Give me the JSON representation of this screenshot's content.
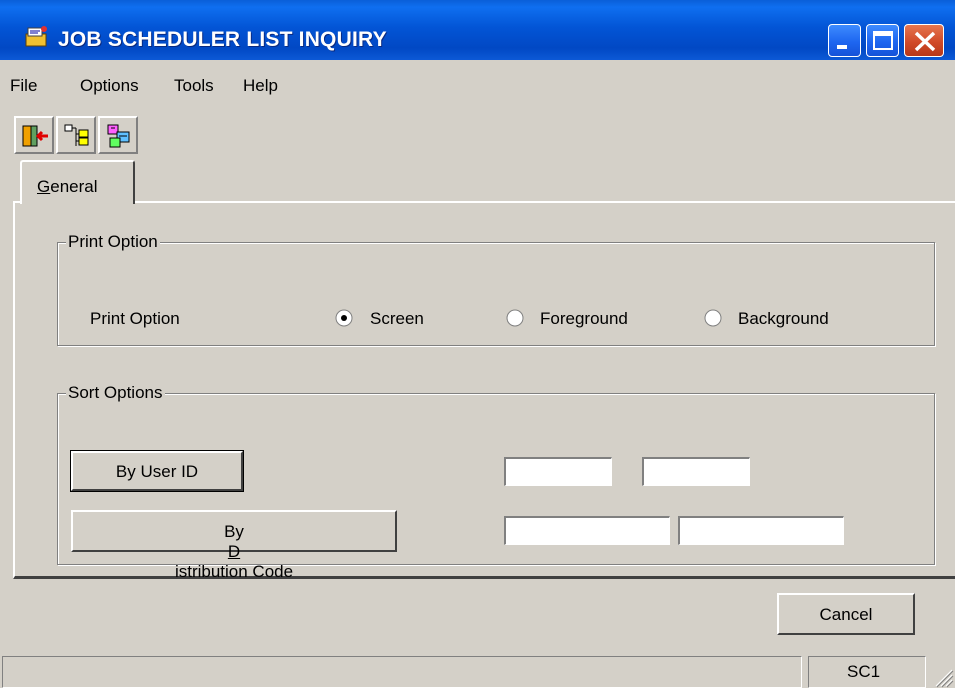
{
  "window": {
    "title": "JOB SCHEDULER LIST INQUIRY"
  },
  "menu": {
    "items": [
      "File",
      "Options",
      "Tools",
      "Help"
    ]
  },
  "toolbar": {
    "icons": [
      "exit-icon",
      "tree-icon",
      "schedule-icon"
    ]
  },
  "tabs": [
    {
      "label": "General",
      "accesskey": "G",
      "rest": "eneral"
    }
  ],
  "print_option": {
    "group_label": "Print Option",
    "field_label": "Print Option",
    "options": [
      {
        "label": "Screen",
        "selected": true
      },
      {
        "label": "Foreground",
        "selected": false
      },
      {
        "label": "Background",
        "selected": false
      }
    ]
  },
  "sort_options": {
    "group_label": "Sort Options",
    "by_user_id": {
      "label": "By User ID",
      "from": "",
      "to": ""
    },
    "by_distribution_code": {
      "label_prefix": "By ",
      "label_accesskey": "D",
      "label_rest": "istribution Code",
      "from": "",
      "to": ""
    }
  },
  "actions": {
    "cancel": "Cancel"
  },
  "status": {
    "left": "",
    "right": "SC1"
  },
  "colors": {
    "titlebar": "#0355d6",
    "face": "#d4d0c8",
    "close_button": "#d14a28"
  }
}
